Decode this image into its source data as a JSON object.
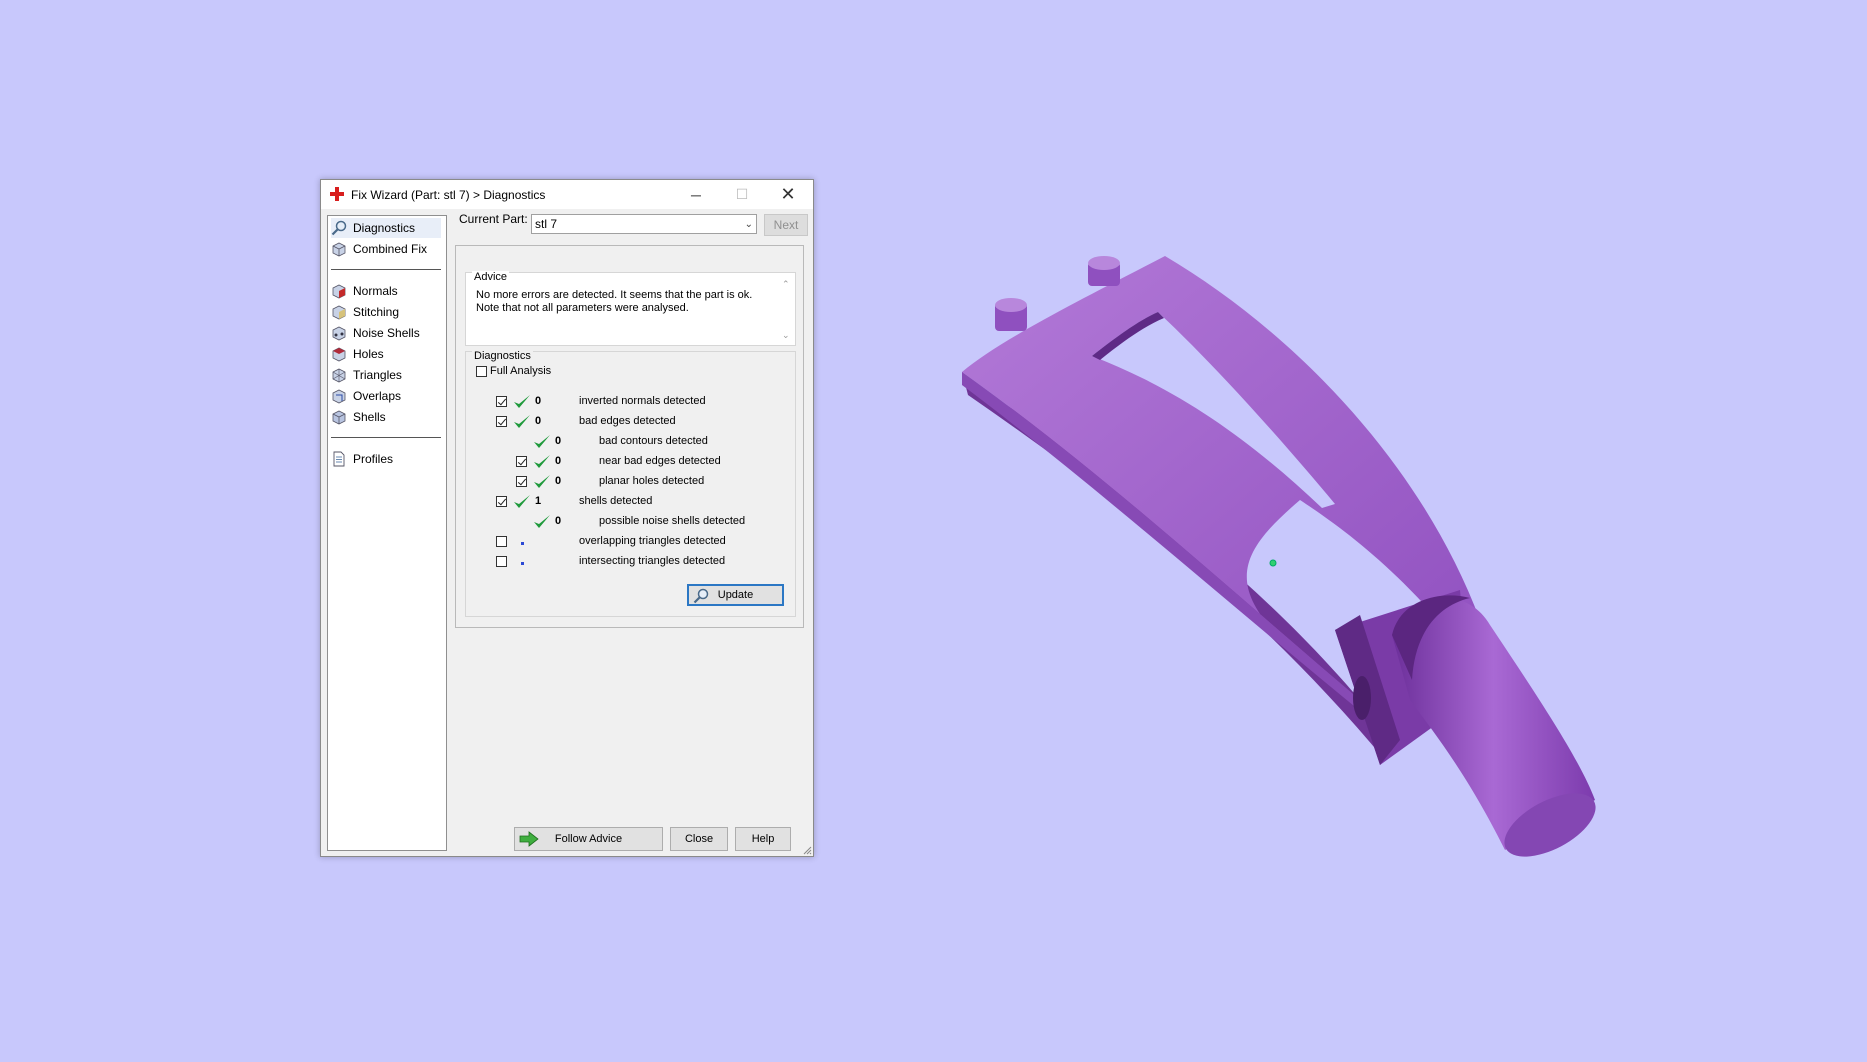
{
  "window": {
    "title": "Fix Wizard (Part: stl 7) > Diagnostics",
    "minimize_glyph": "─",
    "maximize_glyph": "☐",
    "close_glyph": "✕"
  },
  "nav": {
    "items": [
      {
        "label": "Diagnostics",
        "icon": "magnifier-icon",
        "selected": true
      },
      {
        "label": "Combined Fix",
        "icon": "cube-icon"
      },
      {
        "label": "Normals",
        "icon": "normals-cube-icon"
      },
      {
        "label": "Stitching",
        "icon": "stitching-cube-icon"
      },
      {
        "label": "Noise Shells",
        "icon": "noise-shells-cube-icon"
      },
      {
        "label": "Holes",
        "icon": "holes-cube-icon"
      },
      {
        "label": "Triangles",
        "icon": "triangles-cube-icon"
      },
      {
        "label": "Overlaps",
        "icon": "overlaps-cube-icon"
      },
      {
        "label": "Shells",
        "icon": "shells-cube-icon"
      },
      {
        "label": "Profiles",
        "icon": "document-icon"
      }
    ]
  },
  "current_part": {
    "label": "Current Part:",
    "value": "stl 7",
    "next_label": "Next"
  },
  "advice": {
    "label": "Advice",
    "text_line1": "No more errors are detected. It seems that the part is ok.",
    "text_line2": "Note that not all parameters were analysed."
  },
  "diagnostics": {
    "label": "Diagnostics",
    "full_analysis_label": "Full Analysis",
    "full_analysis_checked": false,
    "rows": [
      {
        "count": "0",
        "text": "inverted normals detected",
        "checked": true,
        "ok": true
      },
      {
        "count": "0",
        "text": "bad edges detected",
        "checked": true,
        "ok": true
      },
      {
        "count": "0",
        "text": "bad contours detected",
        "ok": true
      },
      {
        "count": "0",
        "text": "near bad edges detected",
        "checked": true,
        "ok": true
      },
      {
        "count": "0",
        "text": "planar holes detected",
        "checked": true,
        "ok": true
      },
      {
        "count": "1",
        "text": "shells detected",
        "checked": true,
        "ok": true
      },
      {
        "count": "0",
        "text": "possible noise shells detected",
        "ok": true
      },
      {
        "count": "",
        "text": "overlapping triangles detected",
        "checked": false,
        "ok": false
      },
      {
        "count": "",
        "text": "intersecting triangles detected",
        "checked": false,
        "ok": false
      }
    ],
    "update_label": "Update"
  },
  "footer": {
    "follow_advice_label": "Follow Advice",
    "close_label": "Close",
    "help_label": "Help"
  },
  "colors": {
    "viewport_background": "#c8c8fc",
    "part_color": "#a064c8",
    "ok_tick": "#1f9a3c"
  }
}
